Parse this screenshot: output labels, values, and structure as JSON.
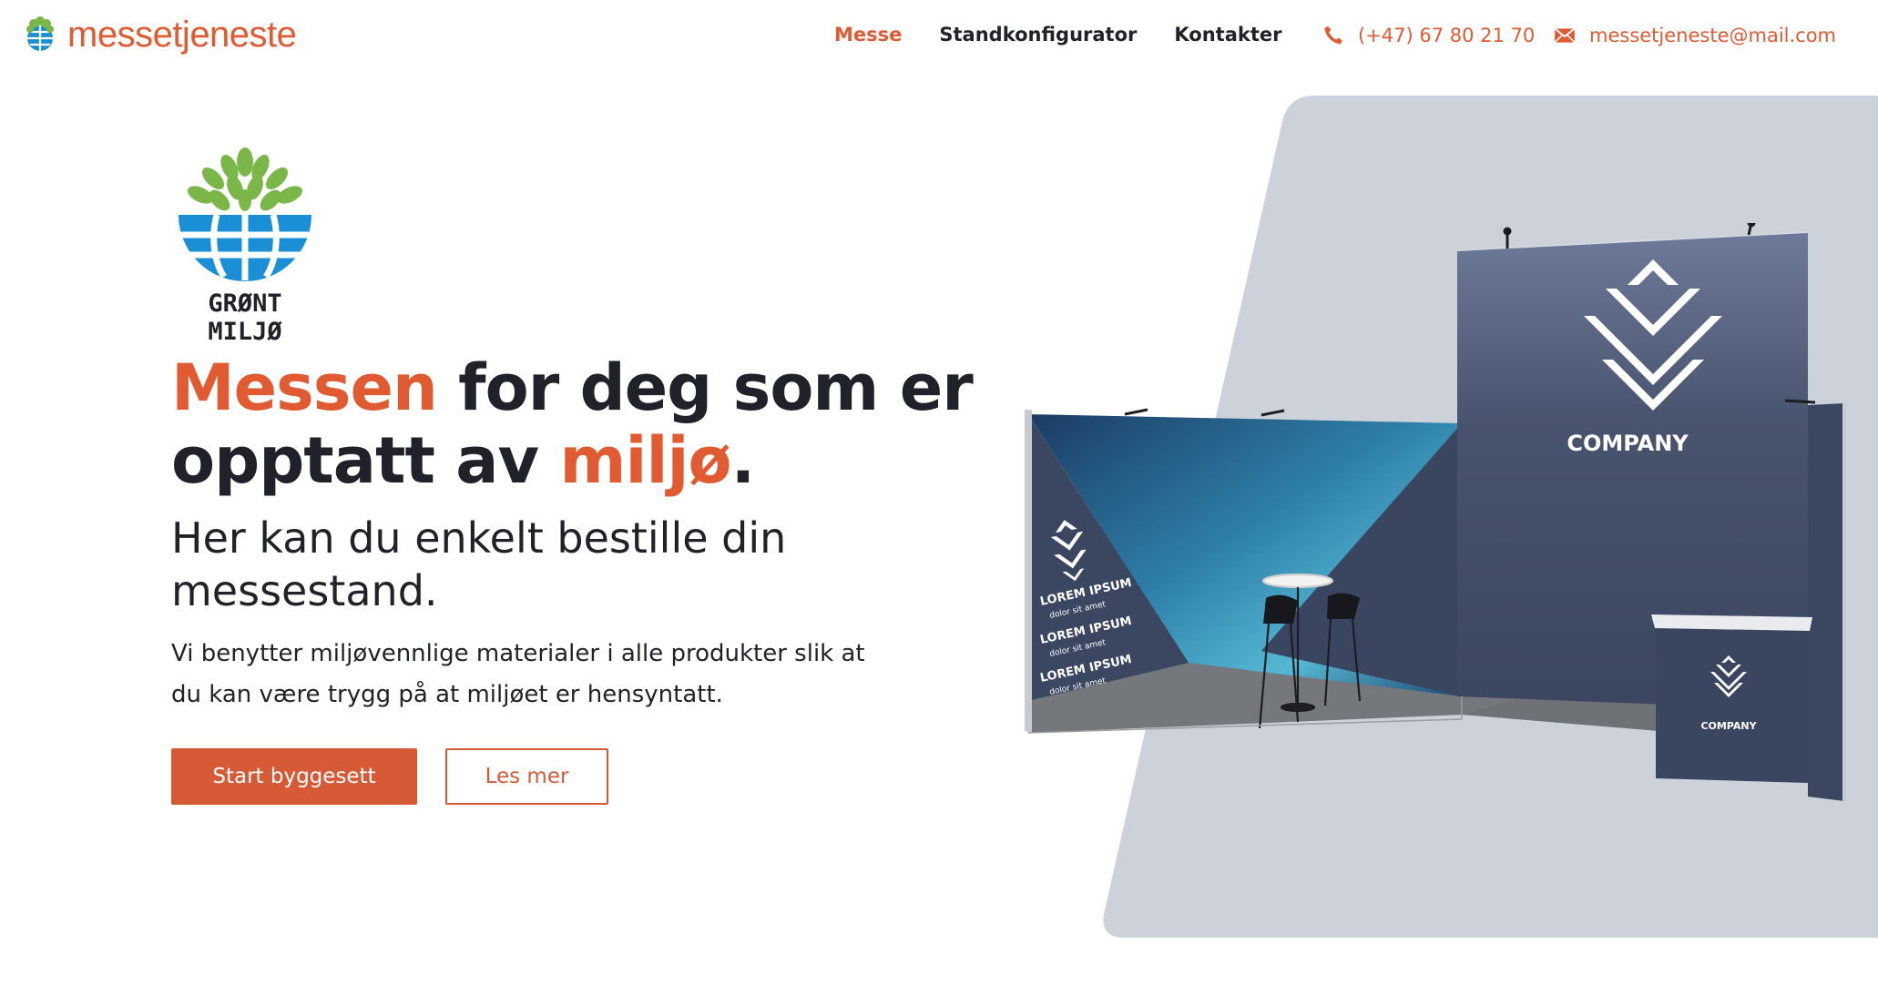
{
  "header": {
    "brand_name": "messetjeneste",
    "brand_icon": "globe-tree-logo-icon",
    "nav": [
      {
        "label": "Messe",
        "active": true
      },
      {
        "label": "Standkonfigurator",
        "active": false
      },
      {
        "label": "Kontakter",
        "active": false
      }
    ],
    "phone": "(+47) 67 80 21 70",
    "phone_icon": "phone-icon",
    "email": "messetjeneste@mail.com",
    "email_icon": "mail-icon"
  },
  "hero": {
    "logo_label": "GRØNT MILJØ",
    "headline_part1": "Messen",
    "headline_part2": " for deg som er opptatt av ",
    "headline_part3": "miljø",
    "headline_part4": ".",
    "subheadline": "Her kan du enkelt bestille din messestand.",
    "body": "Vi benytter miljøvennlige materialer i alle produkter slik at du kan være trygg på at miljøet er hensyntatt.",
    "primary_button": "Start byggesett",
    "secondary_button": "Les mer"
  },
  "booth_image": {
    "company_main": "COMPANY",
    "company_counter": "COMPANY",
    "side_lines": [
      {
        "title": "LOREM IPSUM",
        "sub": "dolor sit amet"
      },
      {
        "title": "LOREM IPSUM",
        "sub": "dolor sit amet"
      },
      {
        "title": "LOREM IPSUM",
        "sub": "dolor sit amet"
      }
    ]
  },
  "colors": {
    "accent": "#e05a32",
    "text": "#1f2228",
    "panel_bg": "#cdd2da",
    "booth_panel": "#3b4660",
    "leaf_green": "#7ab648",
    "globe_blue": "#1a8fd6"
  }
}
